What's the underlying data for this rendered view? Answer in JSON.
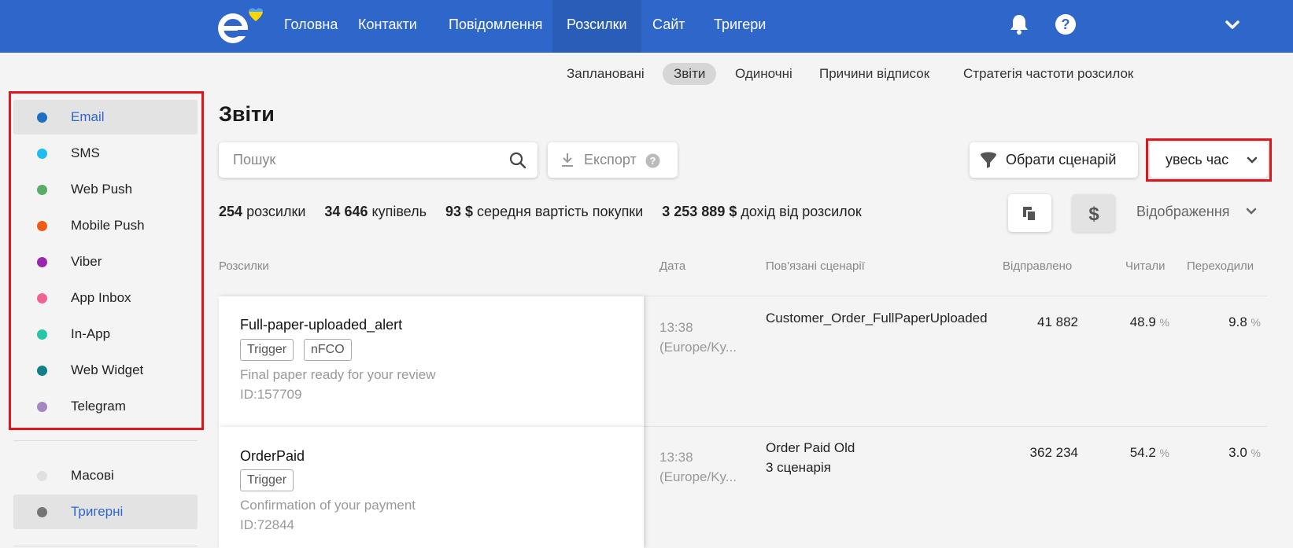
{
  "header": {
    "nav": [
      {
        "label": "Головна"
      },
      {
        "label": "Контакти"
      },
      {
        "label": "Повідомлення"
      },
      {
        "label": "Розсилки"
      },
      {
        "label": "Сайт"
      },
      {
        "label": "Тригери"
      }
    ],
    "active_nav": "Розсилки",
    "icons": [
      "bell-icon",
      "help-icon",
      "chevron-down-icon"
    ],
    "brand_color": "#2f66c9"
  },
  "subnav": {
    "items": [
      {
        "label": "Заплановані"
      },
      {
        "label": "Звіти"
      },
      {
        "label": "Одиночні"
      },
      {
        "label": "Причини відписок"
      },
      {
        "label": "Стратегія частоти розсилок"
      }
    ],
    "active": "Звіти"
  },
  "sidebar": {
    "channels": [
      {
        "label": "Email",
        "color": "#1e6fbf"
      },
      {
        "label": "SMS",
        "color": "#1ebcf0"
      },
      {
        "label": "Web Push",
        "color": "#5aad67"
      },
      {
        "label": "Mobile Push",
        "color": "#ef5a14"
      },
      {
        "label": "Viber",
        "color": "#9b27af"
      },
      {
        "label": "App Inbox",
        "color": "#f06292"
      },
      {
        "label": "In-App",
        "color": "#26c6a6"
      },
      {
        "label": "Web Widget",
        "color": "#128089"
      },
      {
        "label": "Telegram",
        "color": "#a487c0"
      }
    ],
    "types": [
      {
        "label": "Масові",
        "color": "#e0e0e0"
      },
      {
        "label": "Тригерні",
        "color": "#757575"
      }
    ]
  },
  "main": {
    "title": "Звіти",
    "search_placeholder": "Пошук",
    "export_label": "Експорт",
    "scenario_label": "Обрати сценарій",
    "period_label": "увесь час",
    "view_label": "Відображення",
    "stats": [
      {
        "value": "254",
        "label": "розсилки"
      },
      {
        "value": "34 646",
        "label": "купівель"
      },
      {
        "value": "93 $",
        "label": "середня вартість покупки"
      },
      {
        "value": "3 253 889 $",
        "label": "дохід від розсилок"
      }
    ]
  },
  "table": {
    "columns": [
      "Розсилки",
      "Дата",
      "Пов'язані сценарії",
      "Відправлено",
      "Читали",
      "Переходили"
    ],
    "rows": [
      {
        "name": "Full-paper-uploaded_alert",
        "tags": [
          "Trigger",
          "nFCO"
        ],
        "subject": "Final paper ready for your review",
        "id": "ID:157709",
        "time": "13:38",
        "tz": "(Europe/Ky...",
        "scenario": "Customer_Order_FullPaperUploaded",
        "scenario_extra": "",
        "sent": "41 882",
        "read": "48.9",
        "clicked": "9.8"
      },
      {
        "name": "OrderPaid",
        "tags": [
          "Trigger"
        ],
        "subject": "Confirmation of your payment",
        "id": "ID:72844",
        "time": "13:38",
        "tz": "(Europe/Ky...",
        "scenario": "Order Paid Old",
        "scenario_extra": "3 сценарія",
        "sent": "362 234",
        "read": "54.2",
        "clicked": "3.0"
      }
    ],
    "pct_symbol": "%"
  }
}
